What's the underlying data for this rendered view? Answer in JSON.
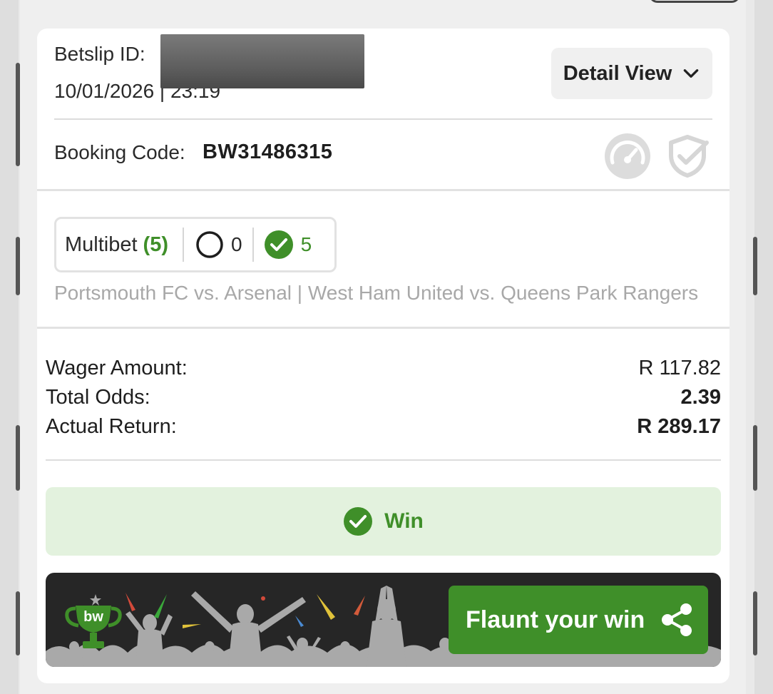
{
  "header": {
    "betslip_id_label": "Betslip ID:",
    "datetime": "10/01/2026 | 23:19",
    "detail_view_label": "Detail View"
  },
  "booking": {
    "label": "Booking Code:",
    "code": "BW31486315"
  },
  "multibet": {
    "label": "Multibet",
    "count": "(5)",
    "open_count": "0",
    "won_count": "5"
  },
  "matches_text": "Portsmouth FC vs. Arsenal | West Ham United vs. Queens Park Rangers",
  "summary": {
    "wager_label": "Wager Amount:",
    "wager_value": "R 117.82",
    "odds_label": "Total Odds:",
    "odds_value": "2.39",
    "return_label": "Actual Return:",
    "return_value": "R 289.17"
  },
  "result": {
    "label": "Win"
  },
  "promo": {
    "trophy_text": "bw",
    "flaunt_label": "Flaunt your win"
  },
  "icons": {
    "chevron": "chevron-down-icon",
    "gauge": "speedometer-icon",
    "shield": "shield-check-icon",
    "open": "circle-outline-icon",
    "won": "check-circle-icon",
    "share": "share-icon",
    "trophy": "trophy-icon"
  },
  "colors": {
    "accent_green": "#3f8f29",
    "win_bg": "#e3f2de",
    "promo_bg": "#262626",
    "muted_text": "#a8a8a8"
  }
}
